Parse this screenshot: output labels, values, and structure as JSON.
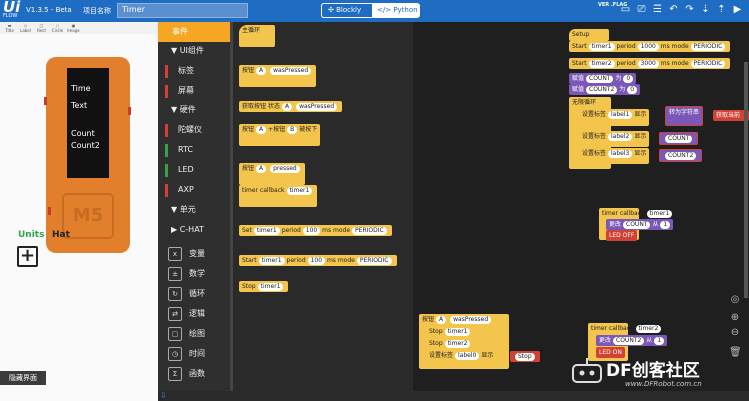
{
  "top": {
    "logo": "Ui",
    "logo_sub": "FLOW",
    "version": "V1.3.5 - Beta",
    "project_label": "项目名称",
    "project_name": "Timer",
    "tab_blockly": "Blockly",
    "tab_python": "Python",
    "ver_badge": "VER\n.FLAG"
  },
  "tools": [
    "Title",
    "Label",
    "Rect",
    "Circle",
    "Image"
  ],
  "device": {
    "lines": [
      "Time",
      "Text",
      "Count",
      "Count2"
    ],
    "logo": "M5"
  },
  "units_label": "Units",
  "hat_label": "Hat",
  "hide_label": "隐藏界面",
  "categories": {
    "active": "事件",
    "ui": "UI组件",
    "ui_items": [
      "标签",
      "屏幕"
    ],
    "hw": "硬件",
    "hw_items": [
      "陀螺仪",
      "RTC",
      "LED",
      "AXP"
    ],
    "units": "单元",
    "chat": "C-HAT",
    "items2": [
      "变量",
      "数学",
      "循环",
      "逻辑",
      "绘图",
      "时间",
      "函数"
    ]
  },
  "palette": {
    "b1": "主循环",
    "b2a": "按钮",
    "b2b": "A",
    "b2c": "wasPressed",
    "b3a": "获取按钮",
    "b3b": "状态",
    "b3c": "A",
    "b3d": "wasPressed",
    "b4a": "按钮",
    "b4b": "A",
    "b4c": "+按钮",
    "b4d": "B",
    "b4e": "被按下",
    "b5a": "按钮",
    "b5b": "A",
    "b5c": "pressed",
    "b6a": "timer callback",
    "b6b": "timer1",
    "b7a": "Set",
    "b7b": "timer1",
    "b7c": "period",
    "b7d": "100",
    "b7e": "ms mode",
    "b7f": "PERIODIC",
    "b8a": "Start",
    "b8b": "timer1",
    "b8c": "period",
    "b8d": "100",
    "b8e": "ms mode",
    "b8f": "PERIODIC",
    "b9a": "Stop",
    "b9b": "timer1"
  },
  "setup": {
    "title": "Setup",
    "s1a": "Start",
    "s1b": "timer1",
    "s1c": "period",
    "s1d": "1000",
    "s1e": "ms mode",
    "s1f": "PERIODIC",
    "s2a": "Start",
    "s2b": "timer2",
    "s2c": "period",
    "s2d": "3000",
    "s2e": "ms mode",
    "s2f": "PERIODIC",
    "s3a": "赋值",
    "s3b": "COUNT",
    "s3c": "为",
    "s3d": "0",
    "s4a": "赋值",
    "s4b": "COUNT2",
    "s4c": "为",
    "s4d": "0",
    "loop": "无限循环",
    "l1a": "设置标签",
    "l1b": "label1",
    "l1c": "显示",
    "l1d": "转为字符串",
    "l1e": "获取当前",
    "l2a": "设置标签",
    "l2b": "label2",
    "l2c": "显示",
    "l2d": "COUNT",
    "l3a": "设置标签",
    "l3b": "label3",
    "l3c": "显示",
    "l3d": "COUNT2"
  },
  "cb1": {
    "a": "timer callback",
    "b": "timer1",
    "c": "更改",
    "d": "COUNT",
    "e": "从",
    "f": "1",
    "g": "LED OFF"
  },
  "cb2": {
    "a": "timer callback",
    "b": "timer2",
    "c": "更改",
    "d": "COUNT2",
    "e": "从",
    "f": "1",
    "g": "LED ON"
  },
  "btn": {
    "a": "按钮",
    "b": "A",
    "c": "wasPressed",
    "d": "Stop",
    "e": "timer1",
    "f": "Stop",
    "g": "timer2",
    "h": "设置标签",
    "i": "label0",
    "j": "显示",
    "k": "Stop"
  },
  "watermark": {
    "a": "DF创客社区",
    "b": "www.DFRobot.com.cn"
  }
}
